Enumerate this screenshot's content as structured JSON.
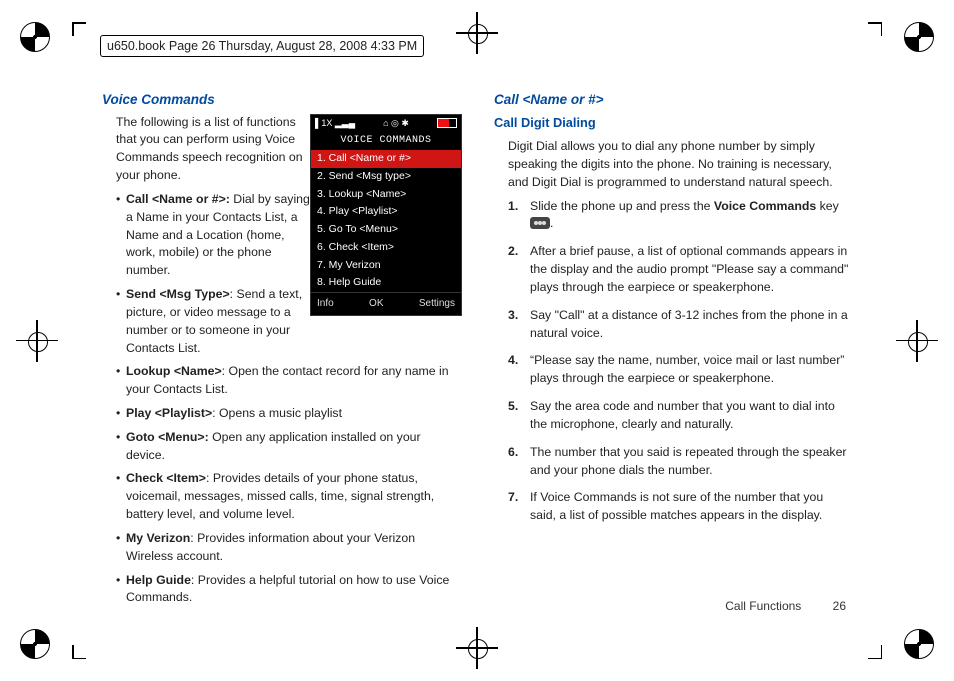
{
  "header": {
    "text": "u650.book  Page 26  Thursday, August 28, 2008  4:33 PM"
  },
  "left": {
    "title": "Voice Commands",
    "intro": "The following is a list of functions that you can perform using Voice Commands speech recognition on your phone.",
    "bullets": [
      {
        "term": "Call <Name or #>:",
        "desc": " Dial by saying a Name in your Contacts List, a Name and a Location (home, work, mobile) or the phone number."
      },
      {
        "term": "Send <Msg Type>",
        "desc": ": Send a text, picture, or video message to a number or to someone in your Contacts List."
      },
      {
        "term": "Lookup <Name>",
        "desc": ": Open the contact record for any name in your Contacts List."
      },
      {
        "term": "Play <Playlist>",
        "desc": ": Opens a music playlist"
      },
      {
        "term": "Goto <Menu>:",
        "desc": " Open any application installed on your device."
      },
      {
        "term": "Check <Item>",
        "desc": ": Provides details of your phone status, voicemail, messages, missed calls, time, signal strength, battery level, and volume level."
      },
      {
        "term": "My Verizon",
        "desc": ": Provides information about your Verizon Wireless account."
      },
      {
        "term": "Help Guide",
        "desc": ": Provides a helpful tutorial on how to use Voice Commands."
      }
    ]
  },
  "right": {
    "title": "Call <Name or #>",
    "subtitle": "Call Digit Dialing",
    "intro": "Digit Dial allows you to dial any phone number by simply speaking the digits into the phone. No training is necessary, and Digit Dial is programmed to understand natural speech.",
    "steps": [
      {
        "pre": "Slide the phone up and press the ",
        "strong": "Voice Commands",
        "post": " key ",
        "icon": true,
        "tail": "."
      },
      {
        "text": "After a brief pause, a list of optional commands appears in the display and the audio prompt \"Please say a command\" plays through the earpiece or speakerphone."
      },
      {
        "text": "Say \"Call\" at a distance of 3-12 inches from the phone in a natural voice."
      },
      {
        "text": "“Please say the name, number, voice mail or last number” plays through the earpiece or speakerphone."
      },
      {
        "text": "Say the area code and number that you want to dial into the microphone, clearly and naturally."
      },
      {
        "text": "The number that you said is repeated through the speaker and your phone dials the number."
      },
      {
        "text": "If Voice Commands is not sure of the number that you said, a list of possible matches appears in the display."
      }
    ]
  },
  "phone": {
    "status_left": "▌1X ▂▃▄",
    "status_mid": "⌂ ◎ ✱",
    "title": "VOICE COMMANDS",
    "rows": [
      "1. Call <Name or #>",
      "2. Send <Msg type>",
      "3. Lookup <Name>",
      "4. Play <Playlist>",
      "5. Go To <Menu>",
      "6. Check <Item>",
      "7. My Verizon",
      "8. Help Guide"
    ],
    "soft_left": "Info",
    "soft_mid": "OK",
    "soft_right": "Settings"
  },
  "footer": {
    "section": "Call Functions",
    "page": "26"
  }
}
